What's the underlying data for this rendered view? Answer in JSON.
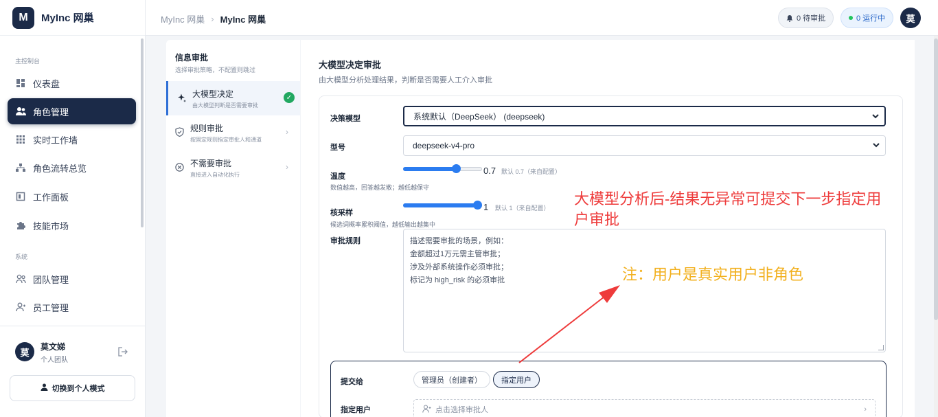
{
  "app": {
    "logo_letter": "M",
    "name": "MyInc 网巢"
  },
  "sidebar": {
    "section_main": "主控制台",
    "section_system": "系统",
    "items": [
      {
        "label": "仪表盘",
        "icon": "dashboard-icon"
      },
      {
        "label": "角色管理",
        "icon": "users-icon",
        "active": true
      },
      {
        "label": "实时工作墙",
        "icon": "grid-icon"
      },
      {
        "label": "角色流转总览",
        "icon": "flow-icon"
      },
      {
        "label": "工作面板",
        "icon": "board-icon"
      },
      {
        "label": "技能市场",
        "icon": "puzzle-icon"
      },
      {
        "label": "团队管理",
        "icon": "team-icon"
      },
      {
        "label": "员工管理",
        "icon": "employee-icon"
      }
    ],
    "user": {
      "avatar": "莫",
      "name": "莫文娣",
      "team": "个人团队"
    },
    "switch_label": "切换到个人模式"
  },
  "header": {
    "breadcrumb": [
      "MyInc 网巢",
      "MyInc 网巢"
    ],
    "pending": "0 待审批",
    "running": "0 运行中",
    "avatar": "莫"
  },
  "steps": {
    "title": "信息审批",
    "subtitle": "选择审批策略，不配置则跳过",
    "items": [
      {
        "title": "大模型决定",
        "desc": "由大模型判断是否需要审批",
        "active": true
      },
      {
        "title": "规则审批",
        "desc": "按固定规则指定审批人和通道"
      },
      {
        "title": "不需要审批",
        "desc": "直接进入自动化执行"
      }
    ]
  },
  "main": {
    "title": "大模型决定审批",
    "subtitle": "由大模型分析处理结果，判断是否需要人工介入审批",
    "model_label": "决策模型",
    "model_value": "系统默认（DeepSeek） (deepseek)",
    "type_label": "型号",
    "type_value": "deepseek-v4-pro",
    "temperature": {
      "label": "温度",
      "hint": "数值越高，回答越发散；越低越保守",
      "value": 0.7,
      "value_text": "0.7",
      "default_text": "默认 0.7（来自配置）"
    },
    "top_p": {
      "label": "核采样",
      "hint": "候选词概率累积阈值，越低输出越集中",
      "value": 1,
      "value_text": "1",
      "default_text": "默认 1（来自配置）"
    },
    "rules_label": "审批规则",
    "rules_placeholder": "描述需要审批的场景，例如：\n金额超过1万元需主管审批；\n涉及外部系统操作必须审批；\n标记为 high_risk 的必须审批",
    "submit": {
      "label": "提交给",
      "options": [
        "管理员（创建者）",
        "指定用户"
      ],
      "selected": "指定用户",
      "user_label": "指定用户",
      "picker_placeholder": "点击选择审批人"
    }
  },
  "annotations": {
    "red_note": "大模型分析后-结果无异常可提交下一步指定用户审批",
    "yellow_note": "注：用户是真实用户非角色",
    "red_color": "#ee3b3b",
    "yellow_color": "#f2b01e"
  },
  "colors": {
    "brand": "#1b2a48",
    "accent": "#2b7cf0",
    "success": "#22a861"
  }
}
